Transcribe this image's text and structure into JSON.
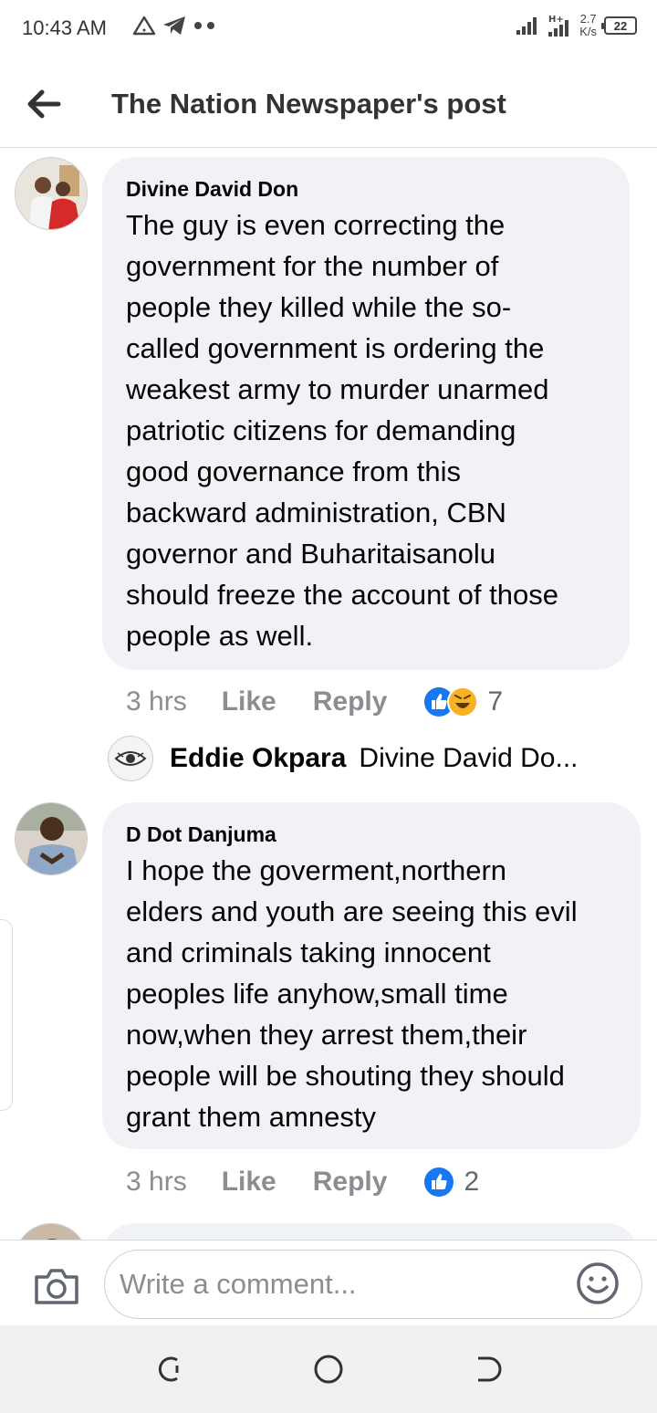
{
  "status_bar": {
    "time": "10:43 AM",
    "net_speed_value": "2.7",
    "net_speed_unit": "K/s",
    "battery": "22",
    "icons": [
      "alert-triangle-icon",
      "telegram-icon",
      "more-dots-icon",
      "signal-icon",
      "signal-h-plus-icon"
    ]
  },
  "header": {
    "title": "The Nation Newspaper's post",
    "back_icon": "arrow-left-icon"
  },
  "comments": [
    {
      "author": "Divine David Don",
      "lines": [
        "The guy is even correcting the",
        "government for the number of",
        "people they killed while the so-",
        "called government is ordering the",
        "weakest army to murder unarmed",
        "patriotic citizens for demanding",
        "good governance from this",
        "backward administration, CBN",
        "governor and Buharitaisanolu",
        "should freeze the account of those",
        "people as well."
      ],
      "time": "3 hrs",
      "like_label": "Like",
      "reply_label": "Reply",
      "reactions": [
        "like",
        "haha"
      ],
      "reaction_count": "7",
      "reply_preview": {
        "author": "Eddie Okpara",
        "snippet": "Divine David Do..."
      }
    },
    {
      "author": "D Dot Danjuma",
      "lines": [
        "I hope the goverment,northern",
        "elders and youth are seeing this evil",
        "and criminals taking innocent",
        "peoples life anyhow,small time",
        "now,when they arrest them,their",
        "people will be shouting they should",
        "grant them amnesty"
      ],
      "time": "3 hrs",
      "like_label": "Like",
      "reply_label": "Reply",
      "reactions": [
        "like"
      ],
      "reaction_count": "2"
    }
  ],
  "composer": {
    "placeholder": "Write a comment...",
    "camera_icon": "camera-icon",
    "emoji_icon": "emoji-icon"
  },
  "colors": {
    "bubble": "#f0f2f5",
    "meta_text": "#8a8d91",
    "like_blue": "#1877f2",
    "haha_yellow": "#f7b125"
  }
}
